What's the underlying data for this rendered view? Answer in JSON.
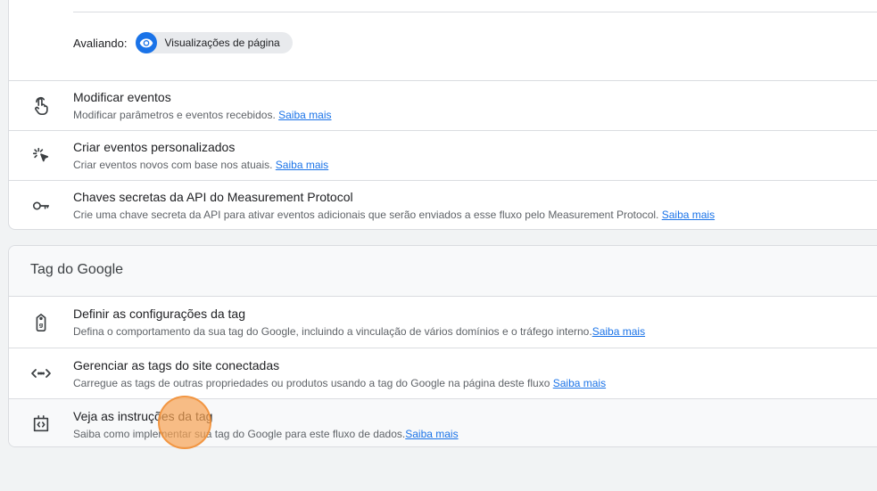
{
  "evaluating": {
    "label": "Avaliando:",
    "chip_label": "Visualizações de página"
  },
  "events": [
    {
      "title": "Modificar eventos",
      "desc": "Modificar parâmetros e eventos recebidos.",
      "link": "Saiba mais",
      "icon": "touch-icon"
    },
    {
      "title": "Criar eventos personalizados",
      "desc": "Criar eventos novos com base nos atuais.",
      "link": "Saiba mais",
      "icon": "click-icon"
    },
    {
      "title": "Chaves secretas da API do Measurement Protocol",
      "desc": "Crie uma chave secreta da API para ativar eventos adicionais que serão enviados a esse fluxo pelo Measurement Protocol.",
      "link": "Saiba mais",
      "icon": "key-icon"
    }
  ],
  "google_tag": {
    "header": "Tag do Google",
    "items": [
      {
        "title": "Definir as configurações da tag",
        "desc": "Defina o comportamento da sua tag do Google, incluindo a vinculação de vários domínios e o tráfego interno.",
        "link": "Saiba mais",
        "icon": "tag-icon"
      },
      {
        "title": "Gerenciar as tags do site conectadas",
        "desc": "Carregue as tags de outras propriedades ou produtos usando a tag do Google na página deste fluxo",
        "link": "Saiba mais",
        "icon": "code-arrows-icon"
      },
      {
        "title": "Veja as instruções da tag",
        "desc": "Saiba como implementar sua tag do Google para este fluxo de dados.",
        "link": "Saiba mais",
        "icon": "code-tag-icon"
      }
    ]
  },
  "colors": {
    "accent": "#1a73e8",
    "cursor_highlight": "#f7a252"
  }
}
